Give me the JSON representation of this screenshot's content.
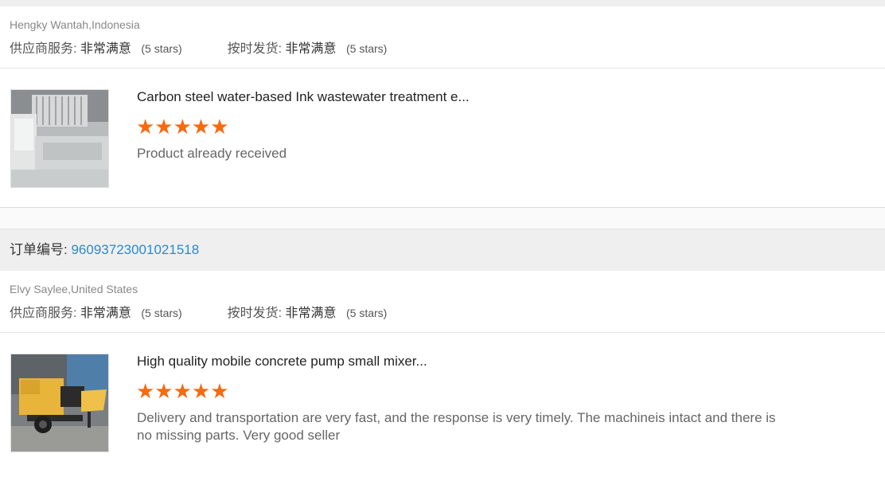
{
  "reviews": [
    {
      "reviewer": "Hengky Wantah,Indonesia",
      "supplier_service_label": "供应商服务:",
      "supplier_service_value": "非常满意",
      "supplier_service_stars": "(5 stars)",
      "ontime_label": "按时发货:",
      "ontime_value": "非常满意",
      "ontime_stars": "(5 stars)",
      "product_title": "Carbon steel water-based Ink wastewater treatment e...",
      "rating": 5,
      "comment": "Product already received"
    },
    {
      "order_label": "订单编号:",
      "order_number": "96093723001021518",
      "reviewer": "Elvy Saylee,United States",
      "supplier_service_label": "供应商服务:",
      "supplier_service_value": "非常满意",
      "supplier_service_stars": "(5 stars)",
      "ontime_label": "按时发货:",
      "ontime_value": "非常满意",
      "ontime_stars": "(5 stars)",
      "product_title": "High quality mobile concrete pump small mixer...",
      "rating": 5,
      "comment": "Delivery and transportation are very fast, and the response is very timely.  The machineis intact and there is no missing parts.  Very good seller"
    }
  ],
  "colors": {
    "star": "#f76a10",
    "order_number": "#2f89c7"
  },
  "star_glyph": "★★★★★"
}
